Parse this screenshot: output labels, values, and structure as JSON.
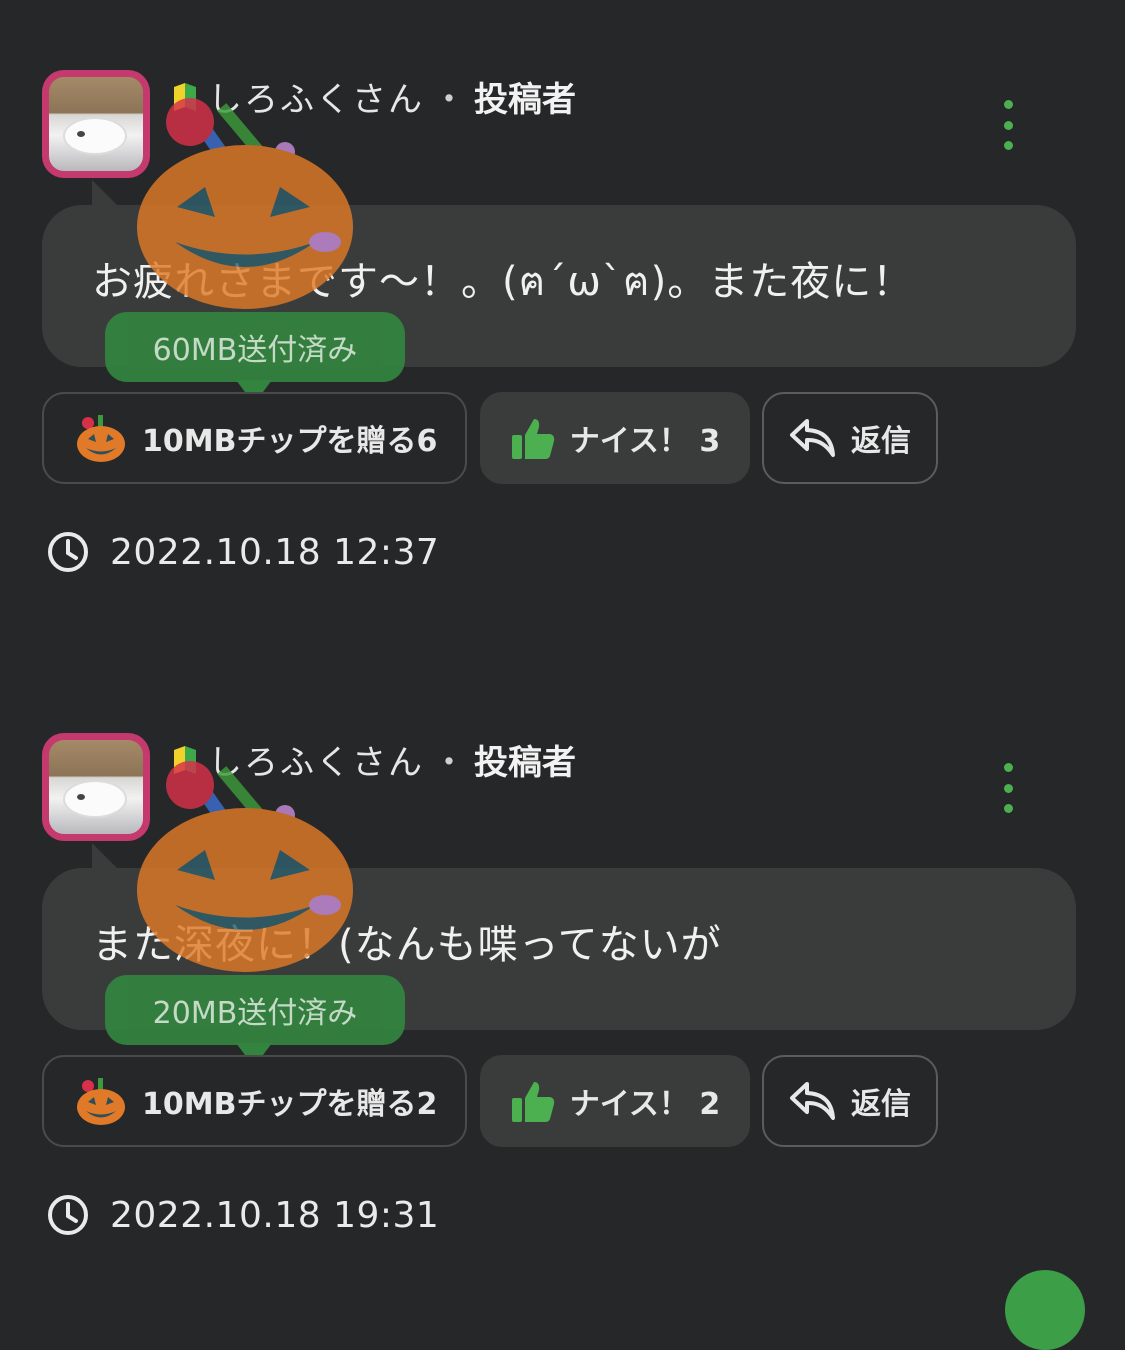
{
  "posts": [
    {
      "user_name": "しろふくさん",
      "separator": "・",
      "role": "投稿者",
      "message": "お疲れさまです〜！。(ฅ´ω`ฅ)。また夜に！",
      "sent_status": "60MB送付済み",
      "tip_label": "10MBチップを贈る6",
      "nice_label": "ナイス！ 3",
      "reply_label": "返信",
      "timestamp": "2022.10.18 12:37"
    },
    {
      "user_name": "しろふくさん",
      "separator": "・",
      "role": "投稿者",
      "message": "また深夜に！(なんも喋ってないが",
      "sent_status": "20MB送付済み",
      "tip_label": "10MBチップを贈る2",
      "nice_label": "ナイス！ 2",
      "reply_label": "返信",
      "timestamp": "2022.10.18 19:31"
    }
  ],
  "icons": {
    "more": "more-vertical-icon",
    "tip": "pumpkin-icon",
    "nice": "thumbs-up-icon",
    "reply": "reply-arrow-icon",
    "time": "clock-icon",
    "badge": "beginner-mark-icon"
  },
  "colors": {
    "background": "#262728",
    "bubble": "#3a3c3c",
    "accent_green": "#4caf50",
    "avatar_border": "#c43a6e",
    "pumpkin": "#e07a28"
  }
}
